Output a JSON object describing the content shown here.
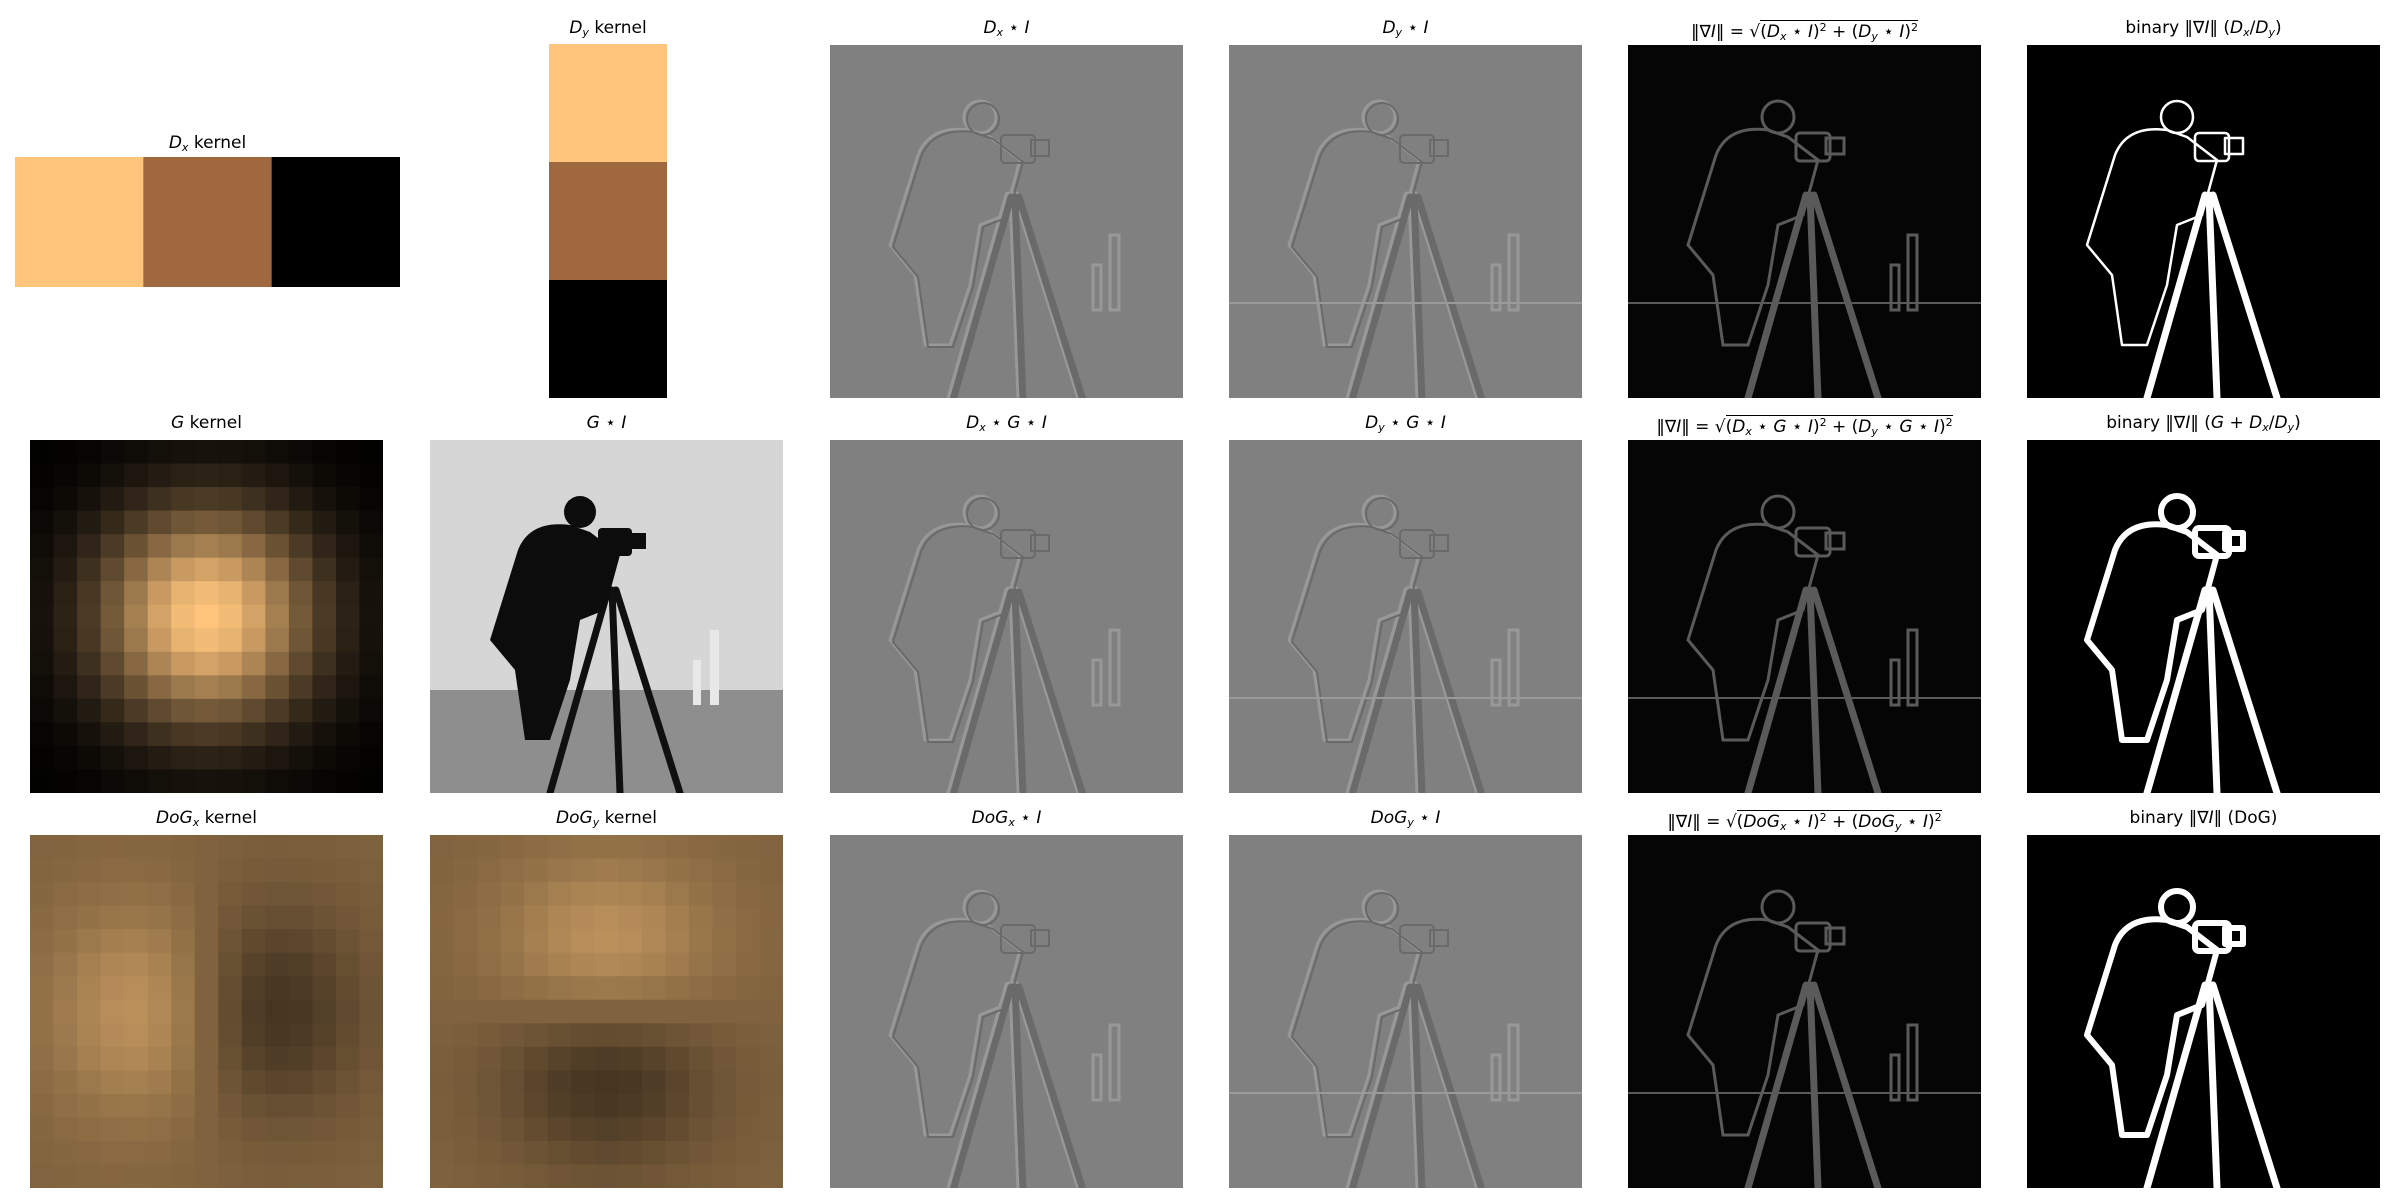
{
  "figure": {
    "rows": [
      [
        {
          "id": "dx-kernel",
          "title_text": "Dx kernel",
          "kind": "kernel-dx"
        },
        {
          "id": "dy-kernel",
          "title_text": "Dy kernel",
          "kind": "kernel-dy"
        },
        {
          "id": "dx-conv-i",
          "title_text": "Dx * I",
          "kind": "emboss-x"
        },
        {
          "id": "dy-conv-i",
          "title_text": "Dy * I",
          "kind": "emboss-y"
        },
        {
          "id": "grad-mag",
          "title_text": "‖∇I‖ = √((Dx * I)² + (Dy * I)²)",
          "kind": "gradient"
        },
        {
          "id": "binary-grad",
          "title_text": "binary ‖∇I‖ (Dx/Dy)",
          "kind": "binary-thin"
        }
      ],
      [
        {
          "id": "g-kernel",
          "title_text": "G kernel",
          "kind": "kernel-g"
        },
        {
          "id": "g-conv-i",
          "title_text": "G * I",
          "kind": "photo"
        },
        {
          "id": "dx-g-conv-i",
          "title_text": "Dx * G * I",
          "kind": "emboss-x"
        },
        {
          "id": "dy-g-conv-i",
          "title_text": "Dy * G * I",
          "kind": "emboss-y"
        },
        {
          "id": "grad-mag-g",
          "title_text": "‖∇I‖ = √((Dx * G * I)² + (Dy * G * I)²)",
          "kind": "gradient"
        },
        {
          "id": "binary-grad-g",
          "title_text": "binary ‖∇I‖ (G + Dx/Dy)",
          "kind": "binary-thick"
        }
      ],
      [
        {
          "id": "dogx-kernel",
          "title_text": "DoGx kernel",
          "kind": "kernel-dogx"
        },
        {
          "id": "dogy-kernel",
          "title_text": "DoGy kernel",
          "kind": "kernel-dogy"
        },
        {
          "id": "dogx-conv-i",
          "title_text": "DoGx * I",
          "kind": "emboss-x"
        },
        {
          "id": "dogy-conv-i",
          "title_text": "DoGy * I",
          "kind": "emboss-y"
        },
        {
          "id": "grad-mag-dog",
          "title_text": "‖∇I‖ = √((DoGx * I)² + (DoGy * I)²)",
          "kind": "gradient"
        },
        {
          "id": "binary-grad-dog",
          "title_text": "binary ‖∇I‖ (DoG)",
          "kind": "binary-thick"
        }
      ]
    ],
    "colormap": [
      "#000000",
      "#a0683f",
      "#ffc57c"
    ]
  }
}
